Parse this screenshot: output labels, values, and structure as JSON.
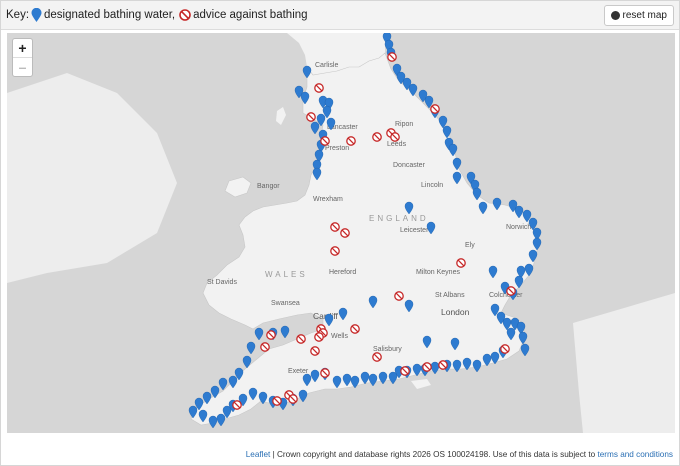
{
  "key": {
    "prefix": "Key:",
    "bathing_label": "designated bathing water,",
    "advice_label": "advice against bathing"
  },
  "reset_button": {
    "label": "reset map",
    "icon": "globe-icon"
  },
  "zoom": {
    "in_label": "+",
    "out_label": "–"
  },
  "attribution": {
    "leaflet": "Leaflet",
    "text": " | Crown copyright and database rights 2026 OS 100024198. Use of this data is subject to ",
    "terms": "terms and conditions"
  },
  "colors": {
    "bathing": "#2e7bd0",
    "advice": "#c62828",
    "land": "#f2f2f2",
    "sea": "#d6d6d6"
  },
  "places": [
    "Carlisle",
    "Lancaster",
    "Preston",
    "Ripon",
    "Leeds",
    "Doncaster",
    "Lincoln",
    "Bangor",
    "Wrexham",
    "Leicester",
    "Norwich",
    "Ely",
    "Hereford",
    "Milton Keynes",
    "St Davids",
    "Colchester",
    "St Albans",
    "Swansea",
    "Cardiff",
    "London",
    "Wells",
    "Salisbury",
    "Exeter"
  ],
  "regions": [
    "ENGLAND",
    "WALES"
  ]
}
